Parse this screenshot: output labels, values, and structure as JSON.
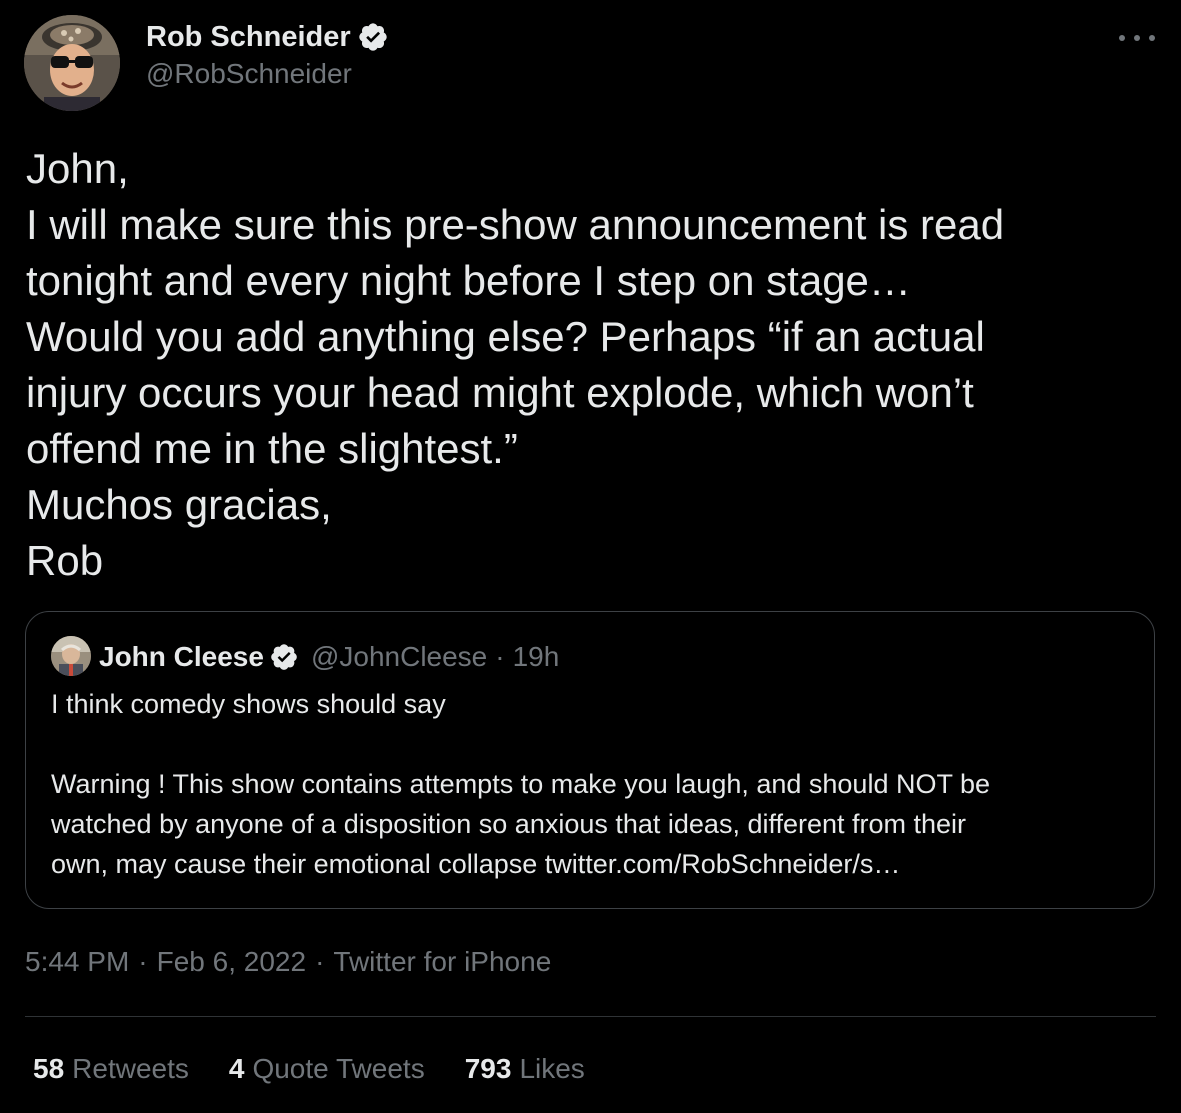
{
  "author": {
    "name": "Rob Schneider",
    "handle": "@RobSchneider",
    "verified_icon": "verified-badge-icon"
  },
  "tweet": {
    "lines": [
      "John,",
      "I will make sure this pre-show announcement is read",
      "tonight and every night before I step on stage…",
      "Would you add anything else? Perhaps “if an actual",
      "injury occurs your head might explode, which won’t",
      "offend me in the slightest.”",
      "Muchos gracias,",
      "Rob"
    ]
  },
  "quote": {
    "name": "John Cleese",
    "handle": "@JohnCleese",
    "separator": "·",
    "time": "19h",
    "lines": [
      "I think comedy shows should say",
      "Warning ! This show contains attempts to make you laugh, and should NOT be",
      "watched by anyone of a disposition so anxious that ideas, different from their",
      "own, may cause their emotional collapse twitter.com/RobSchneider/s…"
    ]
  },
  "meta": {
    "time": "5:44 PM",
    "separator": "·",
    "date": "Feb 6, 2022",
    "source": "Twitter for iPhone"
  },
  "stats": {
    "retweets_count": "58",
    "retweets_label": "Retweets",
    "quotes_count": "4",
    "quotes_label": "Quote Tweets",
    "likes_count": "793",
    "likes_label": "Likes"
  },
  "colors": {
    "background": "#000000",
    "text_primary": "#e7e9ea",
    "text_secondary": "#71767b",
    "border": "#3d4145"
  }
}
